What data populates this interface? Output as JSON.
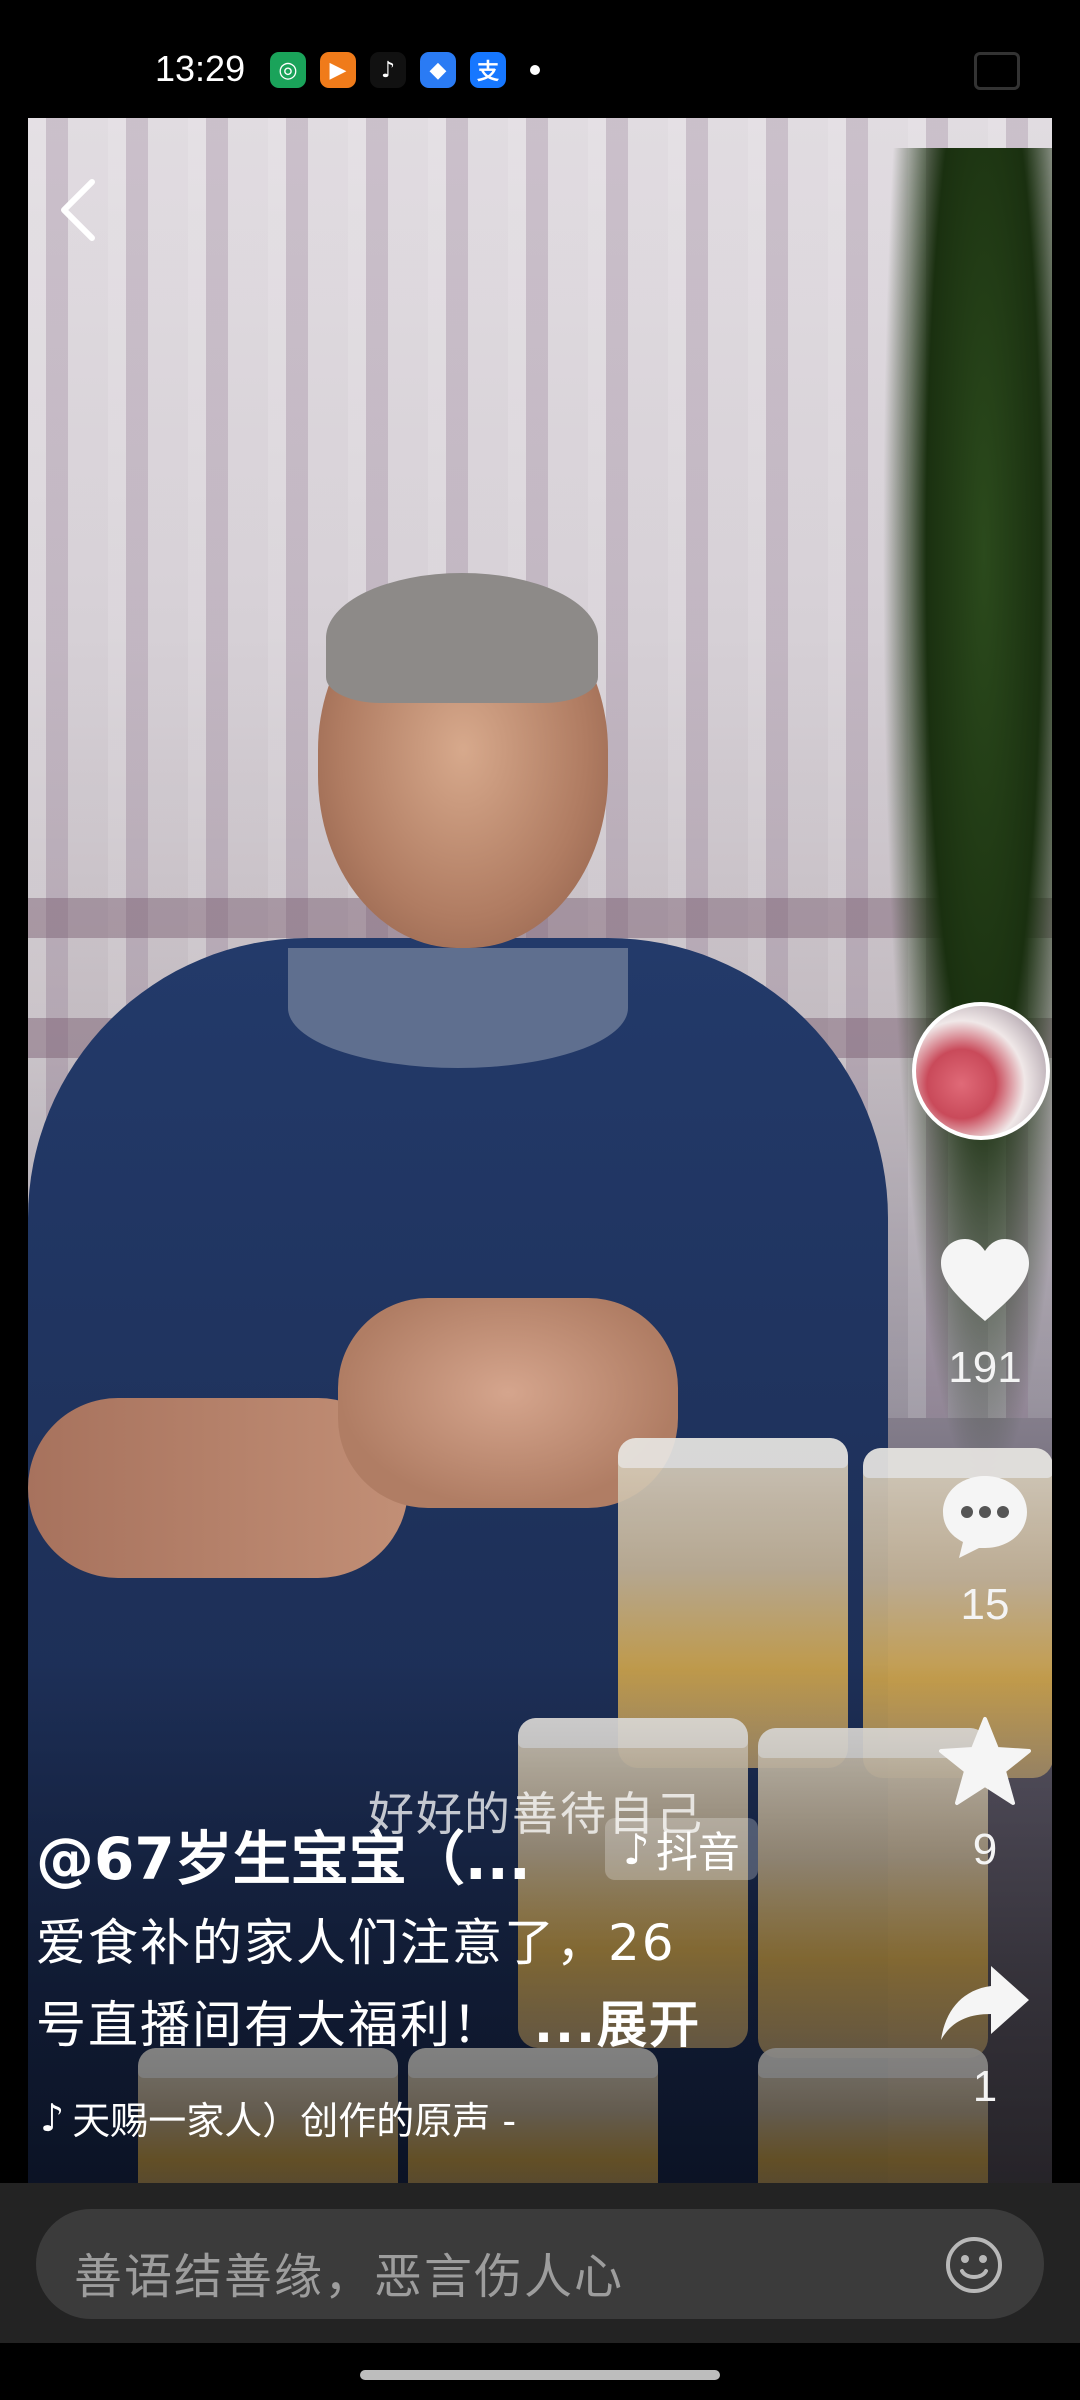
{
  "status_bar": {
    "time": "13:29",
    "apps": [
      {
        "icon": "green-app-icon",
        "color": "#1aa35a",
        "glyph": "◎"
      },
      {
        "icon": "orange-play-app-icon",
        "color": "#f07b1a",
        "glyph": "▶"
      },
      {
        "icon": "douyin-app-icon",
        "color": "#111111",
        "glyph": "♪"
      },
      {
        "icon": "blue-app-icon",
        "color": "#2a7bf4",
        "glyph": "◆"
      },
      {
        "icon": "alipay-app-icon",
        "color": "#1677ff",
        "glyph": "支"
      }
    ]
  },
  "video": {
    "subtitle": "好好的善待自己"
  },
  "rail": {
    "likes": "191",
    "comments": "15",
    "favorites": "9",
    "shares": "1"
  },
  "post": {
    "author": "@67岁生宝宝（...",
    "badge": "抖音",
    "desc_line1": "爱食补的家人们注意了，26",
    "desc_line2": "号直播间有大福利！",
    "expand": "...展开",
    "music": "天赐一家人）创作的原声 -"
  },
  "comment_bar": {
    "placeholder": "善语结善缘，恶言伤人心"
  },
  "colors": {
    "background": "#000000",
    "comment_bar": "#232323",
    "input": "#3b3b3b",
    "placeholder": "#9d9d9d"
  }
}
